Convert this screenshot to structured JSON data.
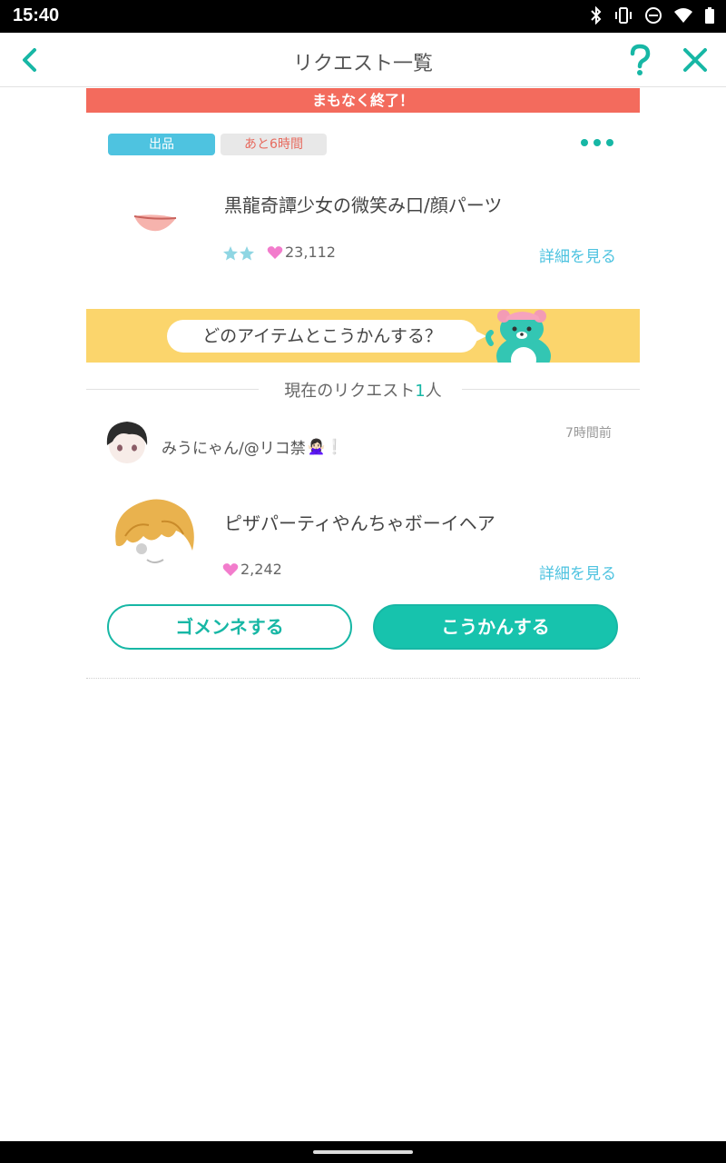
{
  "status_bar": {
    "time": "15:40",
    "icons": [
      "bluetooth-icon",
      "vibrate-icon",
      "do-not-disturb-icon",
      "wifi-icon",
      "battery-icon"
    ]
  },
  "header": {
    "title": "リクエスト一覧",
    "icons": [
      "back-chevron-icon",
      "help-question-icon",
      "close-x-icon"
    ]
  },
  "banner": {
    "text": "まもなく終了！",
    "color": "#f36b5d"
  },
  "listing": {
    "tags": {
      "listed": "出品",
      "time_left": "あと6時間"
    },
    "item_name": "黒龍奇譚少女の微笑み口/顔パーツ",
    "stars": 2,
    "likes": "23,112",
    "detail_link": "詳細を見る"
  },
  "prompt": {
    "text": "どのアイテムとこうかんする？"
  },
  "section": {
    "prefix": "現在のリクエスト",
    "count": "1",
    "suffix": "人"
  },
  "request": {
    "user_name": "みうにゃん/@リコ禁",
    "user_emoji": "🙅🏻‍♀️❕",
    "time_ago": "7時間前",
    "item_name": "ピザパーティやんちゃボーイヘア",
    "likes": "2,242",
    "detail_link": "詳細を見る"
  },
  "actions": {
    "decline": "ゴメンネする",
    "accept": "こうかんする"
  },
  "colors": {
    "accent": "#17b7a5",
    "link": "#4ec3e0",
    "banner_yellow": "#fbd56c",
    "heart": "#f27ccc"
  }
}
